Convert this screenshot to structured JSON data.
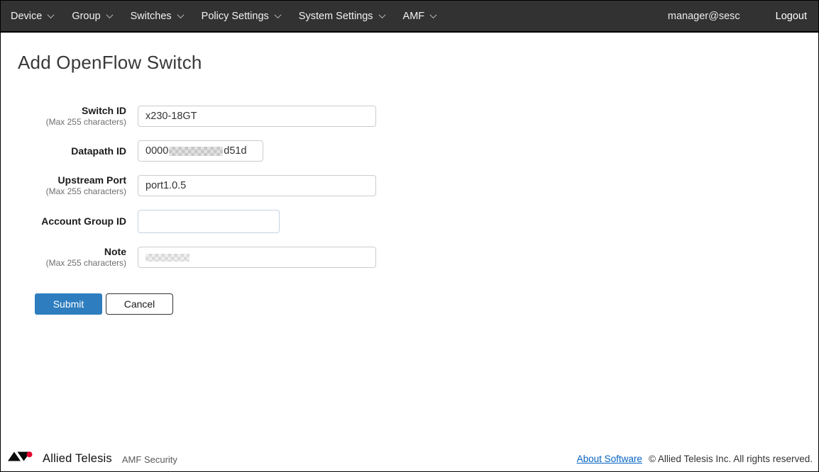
{
  "navbar": {
    "items": [
      "Device",
      "Group",
      "Switches",
      "Policy Settings",
      "System Settings",
      "AMF"
    ],
    "user": "manager@sesc",
    "logout_label": "Logout"
  },
  "page": {
    "title": "Add OpenFlow Switch"
  },
  "form": {
    "fields": [
      {
        "label": "Switch ID",
        "hint": "(Max 255 characters)",
        "value": "x230-18GT"
      },
      {
        "label": "Datapath ID",
        "hint": "",
        "value_prefix": "0000",
        "value_suffix": "d51d",
        "redacted": true
      },
      {
        "label": "Upstream Port",
        "hint": "(Max 255 characters)",
        "value": "port1.0.5"
      },
      {
        "label": "Account Group ID",
        "hint": "",
        "value": ""
      },
      {
        "label": "Note",
        "hint": "(Max 255 characters)",
        "value": "",
        "redacted": true
      }
    ],
    "submit_label": "Submit",
    "cancel_label": "Cancel"
  },
  "footer": {
    "brand": "Allied Telesis",
    "product": "AMF Security",
    "about_link": "About Software",
    "copyright": "© Allied Telesis Inc. All rights reserved."
  },
  "colors": {
    "navbar_bg": "#323232",
    "submit_blue": "#2d7dbf",
    "link_blue": "#0563c1",
    "logo_red": "#e4002b",
    "focused_input_border": "#c6d3e1"
  }
}
